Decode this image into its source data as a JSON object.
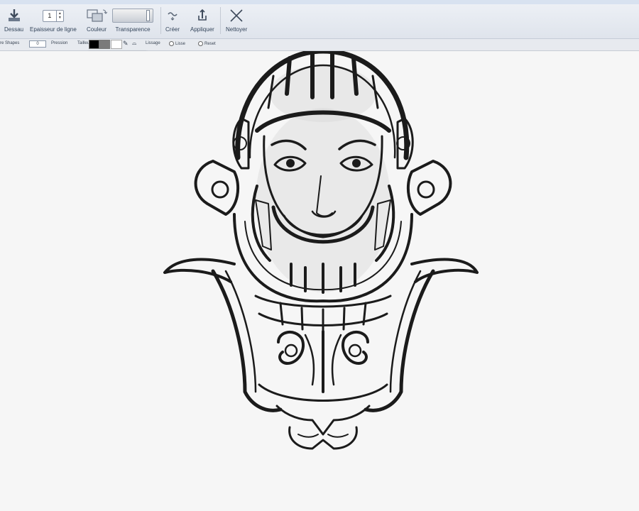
{
  "toolbar": {
    "drawing_label": "Dessau",
    "line_thickness_label": "Epaisseur de ligne",
    "line_thickness_value": "1",
    "color_label": "Couleur",
    "transparency_label": "Transparence",
    "transparency_level_percent": 92,
    "create_label": "Créer",
    "apply_label": "Appliquer",
    "clear_label": "Nettoyer"
  },
  "options": {
    "shapes_label": "re Shapes",
    "shapes_value": "0",
    "pressure_label": "Pression",
    "size_label": "Tailleu",
    "blur_label": "Lissage",
    "smooth_label": "Lisse",
    "reset_label": "Reset"
  },
  "colors": {
    "primary": "#000000",
    "secondary": "#7a7a7a"
  }
}
